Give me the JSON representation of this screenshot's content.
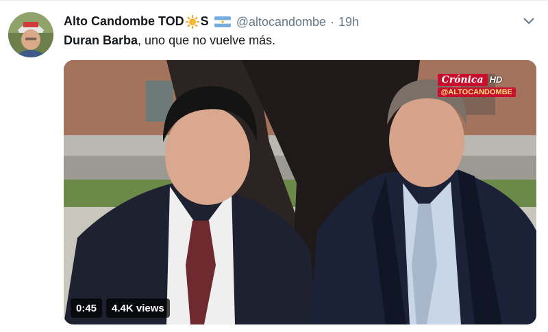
{
  "tweet": {
    "display_name": "Alto Candombe TOD",
    "display_name_suffix": "S",
    "handle": "@altocandombe",
    "separator": "·",
    "time": "19h",
    "text_bold": "Duran Barba",
    "text_rest": ", uno que no vuelve más."
  },
  "video": {
    "duration": "0:45",
    "views": "4.4K views",
    "watermark_brand": "Crónica",
    "watermark_hd": "HD",
    "watermark_handle": "@ALTOCANDOMBE"
  },
  "icons": {
    "name_emoji": "sun-emoji-icon",
    "flag": "argentina-flag-icon",
    "menu": "chevron-down-icon"
  },
  "colors": {
    "secondary_text": "#657786",
    "brand_red": "#c8102e"
  }
}
